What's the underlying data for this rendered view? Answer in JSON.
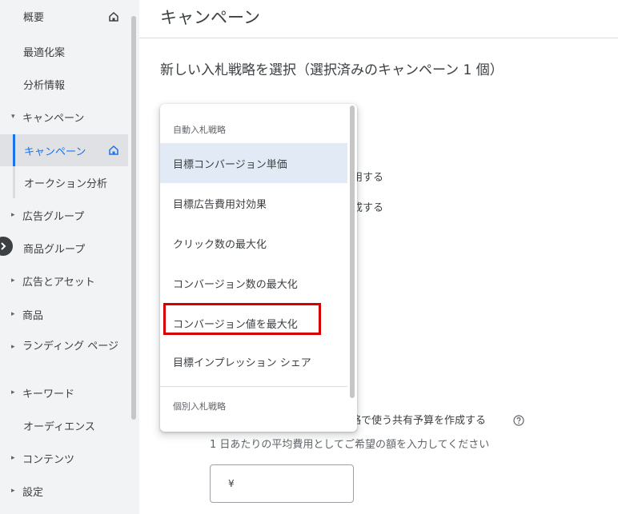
{
  "sidebar": {
    "items": [
      {
        "label": "概要"
      },
      {
        "label": "最適化案"
      },
      {
        "label": "分析情報"
      },
      {
        "label": "キャンペーン",
        "caret": "▾"
      },
      {
        "label": "キャンペーン"
      },
      {
        "label": "オークション分析"
      },
      {
        "label": "広告グループ",
        "caret": "▸"
      },
      {
        "label": "商品グループ"
      },
      {
        "label": "広告とアセット",
        "caret": "▸"
      },
      {
        "label": "商品",
        "caret": "▸"
      },
      {
        "label": "ランディング ページ",
        "caret": "▸"
      },
      {
        "label": "キーワード",
        "caret": "▸"
      },
      {
        "label": "オーディエンス"
      },
      {
        "label": "コンテンツ",
        "caret": "▸"
      },
      {
        "label": "設定",
        "caret": "▸"
      }
    ]
  },
  "main": {
    "page_title": "キャンペーン",
    "section_title": "新しい入札戦略を選択（選択済みのキャンペーン 1 個）",
    "behind_line1": "用する",
    "behind_line2": "成する",
    "shared_budget_text": "略で使う共有予算を作成する",
    "budget_hint": "1 日あたりの平均費用としてご希望の額を入力してください",
    "currency_symbol": "¥"
  },
  "dropdown": {
    "header_auto": "自動入札戦略",
    "options": [
      {
        "label": "目標コンバージョン単価"
      },
      {
        "label": "目標広告費用対効果"
      },
      {
        "label": "クリック数の最大化"
      },
      {
        "label": "コンバージョン数の最大化"
      },
      {
        "label": "コンバージョン値を最大化"
      },
      {
        "label": "目標インプレッション シェア"
      }
    ],
    "header_individual": "個別入札戦略"
  },
  "colors": {
    "accent": "#1a73e8",
    "highlight_box": "#d60000",
    "hover_bg": "#e2ebf5",
    "sidebar_bg": "#f1f3f4"
  }
}
